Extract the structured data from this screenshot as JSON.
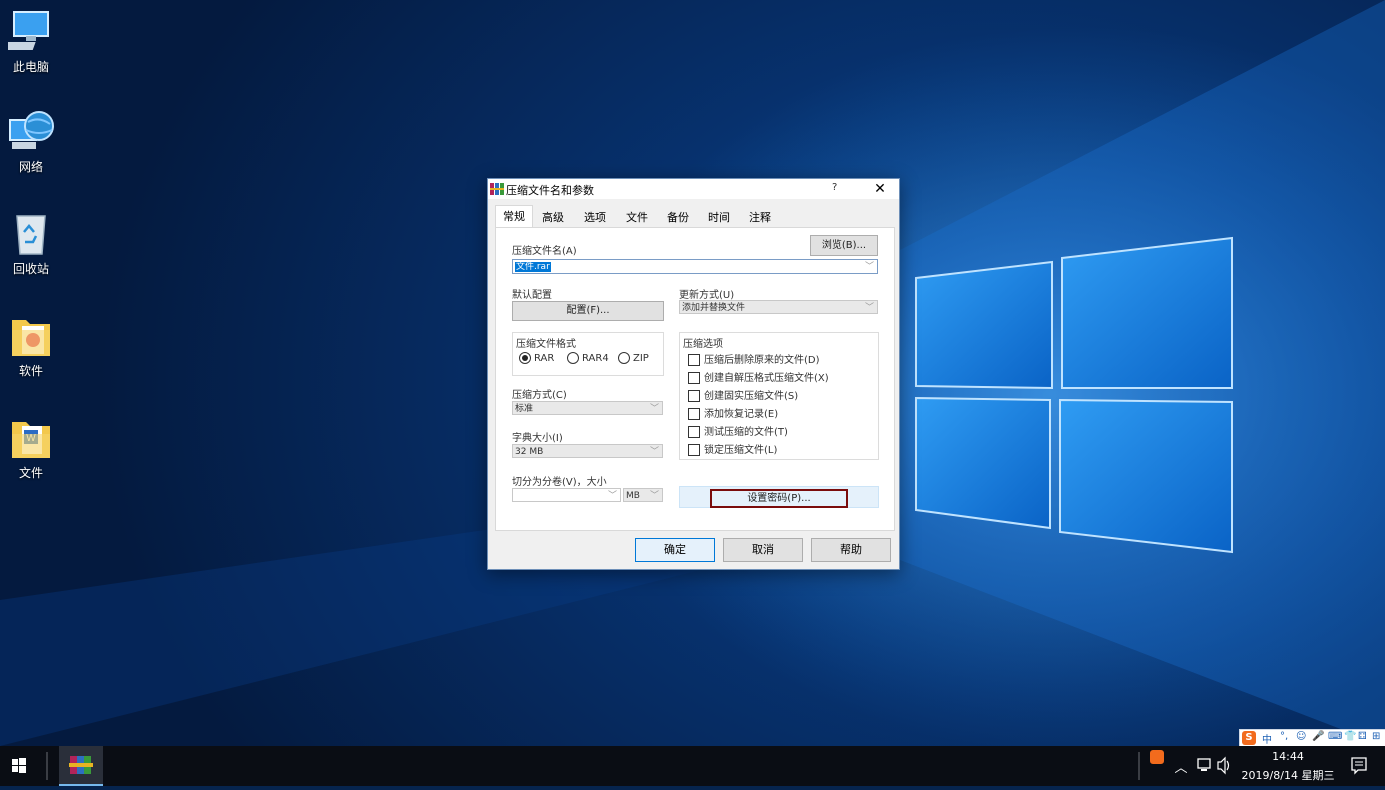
{
  "desktop": {
    "icons": [
      {
        "label": "此电脑",
        "icon": "computer-icon"
      },
      {
        "label": "网络",
        "icon": "network-globe-icon"
      },
      {
        "label": "回收站",
        "icon": "recycle-bin-icon"
      },
      {
        "label": "软件",
        "icon": "folder-icon"
      },
      {
        "label": "文件",
        "icon": "folder-word-icon"
      }
    ]
  },
  "dialog": {
    "title": "压缩文件名和参数",
    "help_label": "?",
    "close_label": "✕",
    "tabs": [
      "常规",
      "高级",
      "选项",
      "文件",
      "备份",
      "时间",
      "注释"
    ],
    "active_tab": "常规",
    "archive_name_label": "压缩文件名(A)",
    "browse_button": "浏览(B)...",
    "archive_name_value": "文件.rar",
    "default_profile_label": "默认配置",
    "profile_button": "配置(F)...",
    "update_mode_label": "更新方式(U)",
    "update_mode_value": "添加并替换文件",
    "format_group_label": "压缩文件格式",
    "formats": [
      {
        "label": "RAR",
        "selected": true
      },
      {
        "label": "RAR4",
        "selected": false
      },
      {
        "label": "ZIP",
        "selected": false
      }
    ],
    "compression_method_label": "压缩方式(C)",
    "compression_method_value": "标准",
    "dictionary_size_label": "字典大小(I)",
    "dictionary_size_value": "32 MB",
    "split_label": "切分为分卷(V)，大小",
    "split_value": "",
    "split_unit": "MB",
    "options_group_label": "压缩选项",
    "options": [
      {
        "label": "压缩后删除原来的文件(D)",
        "checked": false
      },
      {
        "label": "创建自解压格式压缩文件(X)",
        "checked": false
      },
      {
        "label": "创建固实压缩文件(S)",
        "checked": false
      },
      {
        "label": "添加恢复记录(E)",
        "checked": false
      },
      {
        "label": "测试压缩的文件(T)",
        "checked": false
      },
      {
        "label": "锁定压缩文件(L)",
        "checked": false
      }
    ],
    "set_password_button": "设置密码(P)...",
    "ok_button": "确定",
    "cancel_button": "取消",
    "help_button": "帮助",
    "highlight_color": "#7a0c0c"
  },
  "taskbar": {
    "start_icon": "windows-logo-icon",
    "pinned": [
      {
        "name": "winrar-icon",
        "active": true
      }
    ],
    "tray": {
      "time": "14:44",
      "date": "2019/8/14 星期三",
      "icons": [
        "sogou-ime-icon",
        "chevron-up-icon",
        "network-icon",
        "volume-icon",
        "notification-icon"
      ]
    },
    "ime_bar": {
      "items": [
        "S",
        "中",
        "°,",
        "☺",
        "🎤",
        "⌨",
        "👕",
        "⚃",
        "⊞"
      ]
    }
  },
  "colors": {
    "accent": "#0078d7",
    "selection": "#0078d7",
    "taskbar": "#0a0d14"
  }
}
